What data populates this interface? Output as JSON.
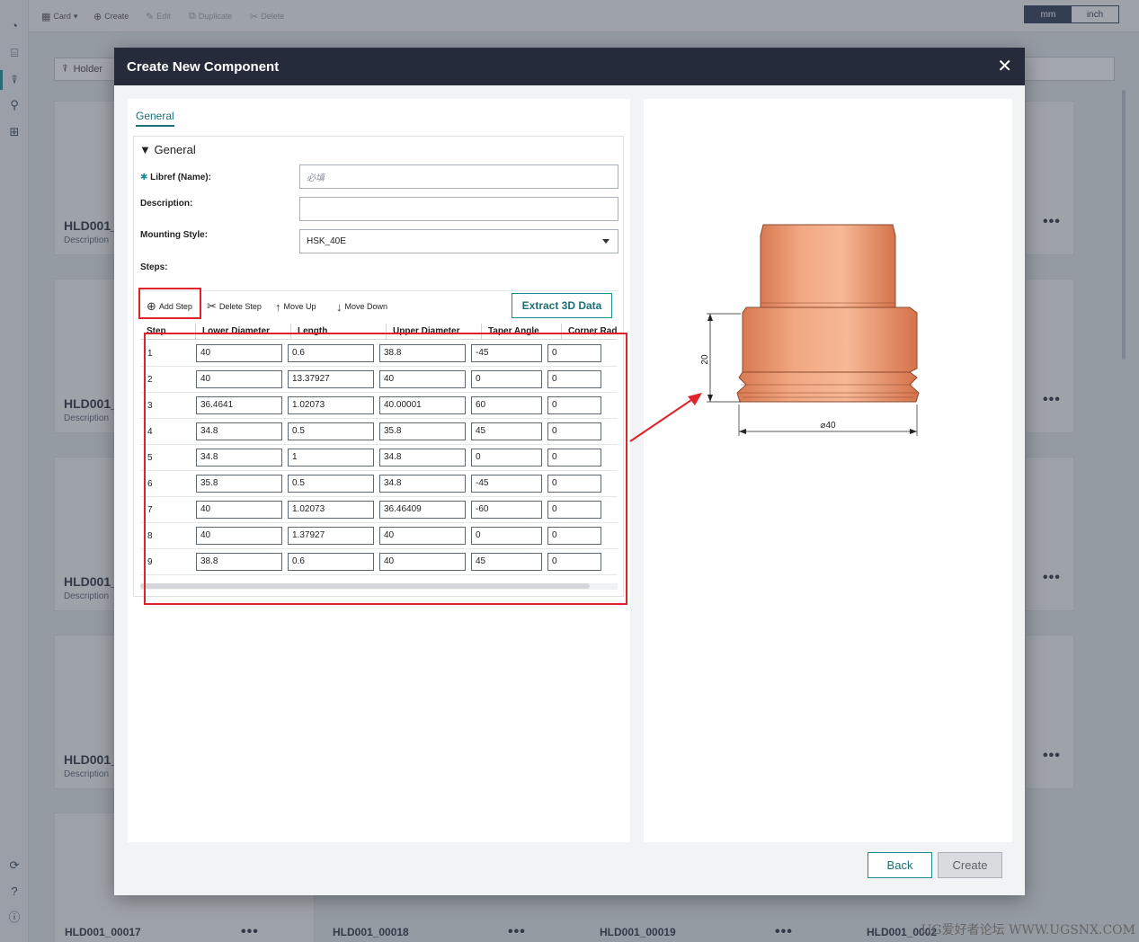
{
  "toolbar": {
    "card_label": "Card",
    "create_label": "Create",
    "edit_label": "Edit",
    "duplicate_label": "Duplicate",
    "delete_label": "Delete"
  },
  "units": {
    "mm_label": "mm",
    "inch_label": "inch",
    "selected": "mm"
  },
  "filter": {
    "holder_label": "Holder"
  },
  "background_cards": [
    {
      "title": "HLD001_",
      "description": "Description"
    },
    {
      "title": "HLD001_",
      "description": "Description"
    },
    {
      "title": "HLD001_",
      "description": "Description"
    },
    {
      "title": "HLD001_",
      "description": "Description"
    }
  ],
  "background_bottom_labels": [
    "HLD001_00017",
    "HLD001_00018",
    "HLD001_00019",
    "HLD001_0002"
  ],
  "modal": {
    "title": "Create New Component",
    "close_symbol": "✕",
    "tab_label": "General",
    "section_title": "▼ General",
    "form": {
      "name_label": "Libref (Name):",
      "name_placeholder": "必填",
      "name_value": "",
      "description_label": "Description:",
      "description_value": "",
      "mounting_label": "Mounting Style:",
      "mounting_value": "HSK_40E",
      "steps_label": "Steps:"
    },
    "step_toolbar": {
      "add_step": "Add Step",
      "delete_step": "Delete Step",
      "move_up": "Move Up",
      "move_down": "Move Down",
      "extract": "Extract 3D Data"
    },
    "table": {
      "headers": [
        "Step",
        "Lower Diameter",
        "Length",
        "Upper Diameter",
        "Taper Angle",
        "Corner Rad"
      ],
      "rows": [
        {
          "step": "1",
          "lower": "40",
          "length": "0.6",
          "upper": "38.8",
          "taper": "-45",
          "corner": "0"
        },
        {
          "step": "2",
          "lower": "40",
          "length": "13.37927",
          "upper": "40",
          "taper": "0",
          "corner": "0"
        },
        {
          "step": "3",
          "lower": "36.4641",
          "length": "1.02073",
          "upper": "40.00001",
          "taper": "60",
          "corner": "0"
        },
        {
          "step": "4",
          "lower": "34.8",
          "length": "0.5",
          "upper": "35.8",
          "taper": "45",
          "corner": "0"
        },
        {
          "step": "5",
          "lower": "34.8",
          "length": "1",
          "upper": "34.8",
          "taper": "0",
          "corner": "0"
        },
        {
          "step": "6",
          "lower": "35.8",
          "length": "0.5",
          "upper": "34.8",
          "taper": "-45",
          "corner": "0"
        },
        {
          "step": "7",
          "lower": "40",
          "length": "1.02073",
          "upper": "36.46409",
          "taper": "-60",
          "corner": "0"
        },
        {
          "step": "8",
          "lower": "40",
          "length": "1.37927",
          "upper": "40",
          "taper": "0",
          "corner": "0"
        },
        {
          "step": "9",
          "lower": "38.8",
          "length": "0.6",
          "upper": "40",
          "taper": "45",
          "corner": "0"
        }
      ]
    },
    "preview": {
      "height_dimension": "20",
      "diameter_dimension": "⌀40",
      "body_color": "#e8936a"
    },
    "buttons": {
      "back": "Back",
      "create": "Create"
    }
  },
  "watermark": "UG爱好者论坛 WWW.UGSNX.COM",
  "colors": {
    "accent": "#1c8a92",
    "header_bg": "#252b3b",
    "highlight": "#e0232b"
  }
}
